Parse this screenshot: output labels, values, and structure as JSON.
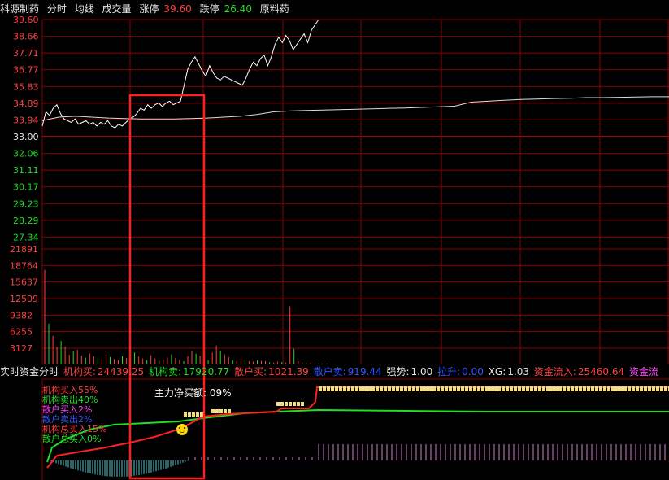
{
  "header": {
    "stock_name": "科源制药",
    "view_mode": "分时",
    "avg_line": "均线",
    "volume": "成交量",
    "limit_up_label": "涨停",
    "limit_up_value": "39.60",
    "limit_down_label": "跌停",
    "limit_down_value": "26.40",
    "sector": "原料药"
  },
  "price_axis": {
    "red_ticks": [
      "39.60",
      "38.66",
      "37.71",
      "36.77",
      "35.83",
      "34.89",
      "33.94"
    ],
    "base": "33.00",
    "green_ticks": [
      "32.06",
      "31.11",
      "30.17",
      "29.23",
      "28.29",
      "27.34"
    ]
  },
  "volume_axis": {
    "ticks": [
      "21891",
      "18764",
      "15637",
      "12509",
      "9382",
      "6255",
      "3127"
    ]
  },
  "fund_bar": {
    "title": "实时资金分时",
    "inst_buy_label": "机构买:",
    "inst_buy_value": "24439.25",
    "inst_sell_label": "机构卖:",
    "inst_sell_value": "17920.77",
    "retail_buy_label": "散户买:",
    "retail_buy_value": "1021.39",
    "retail_sell_label": "散户卖:",
    "retail_sell_value": "919.44",
    "strength_label": "强势:",
    "strength_value": "1.00",
    "pull_label": "拉升:",
    "pull_value": "0.00",
    "xg_label": "XG:",
    "xg_value": "1.03",
    "inflow_label": "资金流入:",
    "inflow_value": "25460.64",
    "inflow2_label": "资金流"
  },
  "legend": {
    "inst_buy_in": "机构买入55%",
    "inst_sell_out": "机构卖出40%",
    "retail_buy_in": "散户买入2%",
    "retail_sell_out": "散户卖出2%",
    "inst_total_buy": "机构总买入15%",
    "retail_total_buy": "散户总买入0%"
  },
  "net_buy": "主力净买额: 09%",
  "colors": {
    "grid": "#8b0000",
    "up": "#ff4040",
    "down": "#22dd22",
    "price_line": "#ffffff",
    "highlight_box": "#ff2020",
    "blocks": "#f0e080"
  },
  "chart_data": {
    "type": "line",
    "ylim": [
      26.4,
      39.6
    ],
    "base_price": 33.0,
    "price": [
      33.6,
      34.4,
      34.2,
      34.6,
      34.8,
      34.3,
      34.0,
      33.9,
      33.8,
      34.0,
      33.7,
      33.8,
      33.9,
      33.7,
      33.8,
      33.6,
      33.8,
      33.7,
      33.9,
      33.6,
      33.5,
      33.7,
      33.6,
      33.8,
      34.0,
      34.1,
      34.3,
      34.6,
      34.5,
      34.8,
      34.6,
      34.8,
      34.9,
      34.7,
      34.9,
      35.0,
      34.8,
      34.9,
      35.0,
      35.9,
      36.8,
      37.2,
      37.5,
      37.1,
      36.7,
      36.4,
      37.0,
      36.6,
      36.3,
      36.2,
      36.4,
      36.3,
      36.2,
      36.1,
      36.0,
      35.9,
      36.3,
      36.8,
      37.2,
      37.0,
      37.4,
      37.6,
      37.0,
      37.5,
      38.2,
      38.6,
      38.3,
      38.7,
      38.4,
      37.9,
      38.2,
      38.5,
      38.8,
      38.3,
      39.0,
      39.3,
      39.6
    ],
    "avg_price": [
      33.9,
      34.1,
      34.15,
      34.1,
      34.05,
      34.02,
      34.0,
      34.0,
      34.0,
      34.02,
      34.05,
      34.1,
      34.15,
      34.25,
      34.4,
      34.45,
      34.48,
      34.5,
      34.52,
      34.55,
      34.57,
      34.6,
      34.62,
      34.65,
      34.68,
      34.72,
      34.95,
      35.0,
      35.05,
      35.1,
      35.12,
      35.15,
      35.17,
      35.2,
      35.2,
      35.22,
      35.23,
      35.25,
      35.25
    ],
    "volume": [
      20500,
      8800,
      6200,
      3800,
      5100,
      3900,
      2100,
      2800,
      3200,
      1900,
      1500,
      2400,
      1800,
      1300,
      1100,
      2200,
      1600,
      1200,
      900,
      1800,
      1400,
      1000,
      2600,
      1700,
      1300,
      900,
      2000,
      1300,
      800,
      1100,
      1500,
      2200,
      1400,
      1000,
      700,
      1800,
      2900,
      2300,
      1900,
      1300,
      900,
      2600,
      4100,
      3000,
      2200,
      1600,
      900,
      700,
      1300,
      1000,
      700,
      600,
      900,
      800,
      700,
      500,
      400,
      600,
      500,
      400,
      12600,
      3400,
      700,
      500,
      300,
      250,
      200,
      200,
      180,
      150
    ]
  }
}
